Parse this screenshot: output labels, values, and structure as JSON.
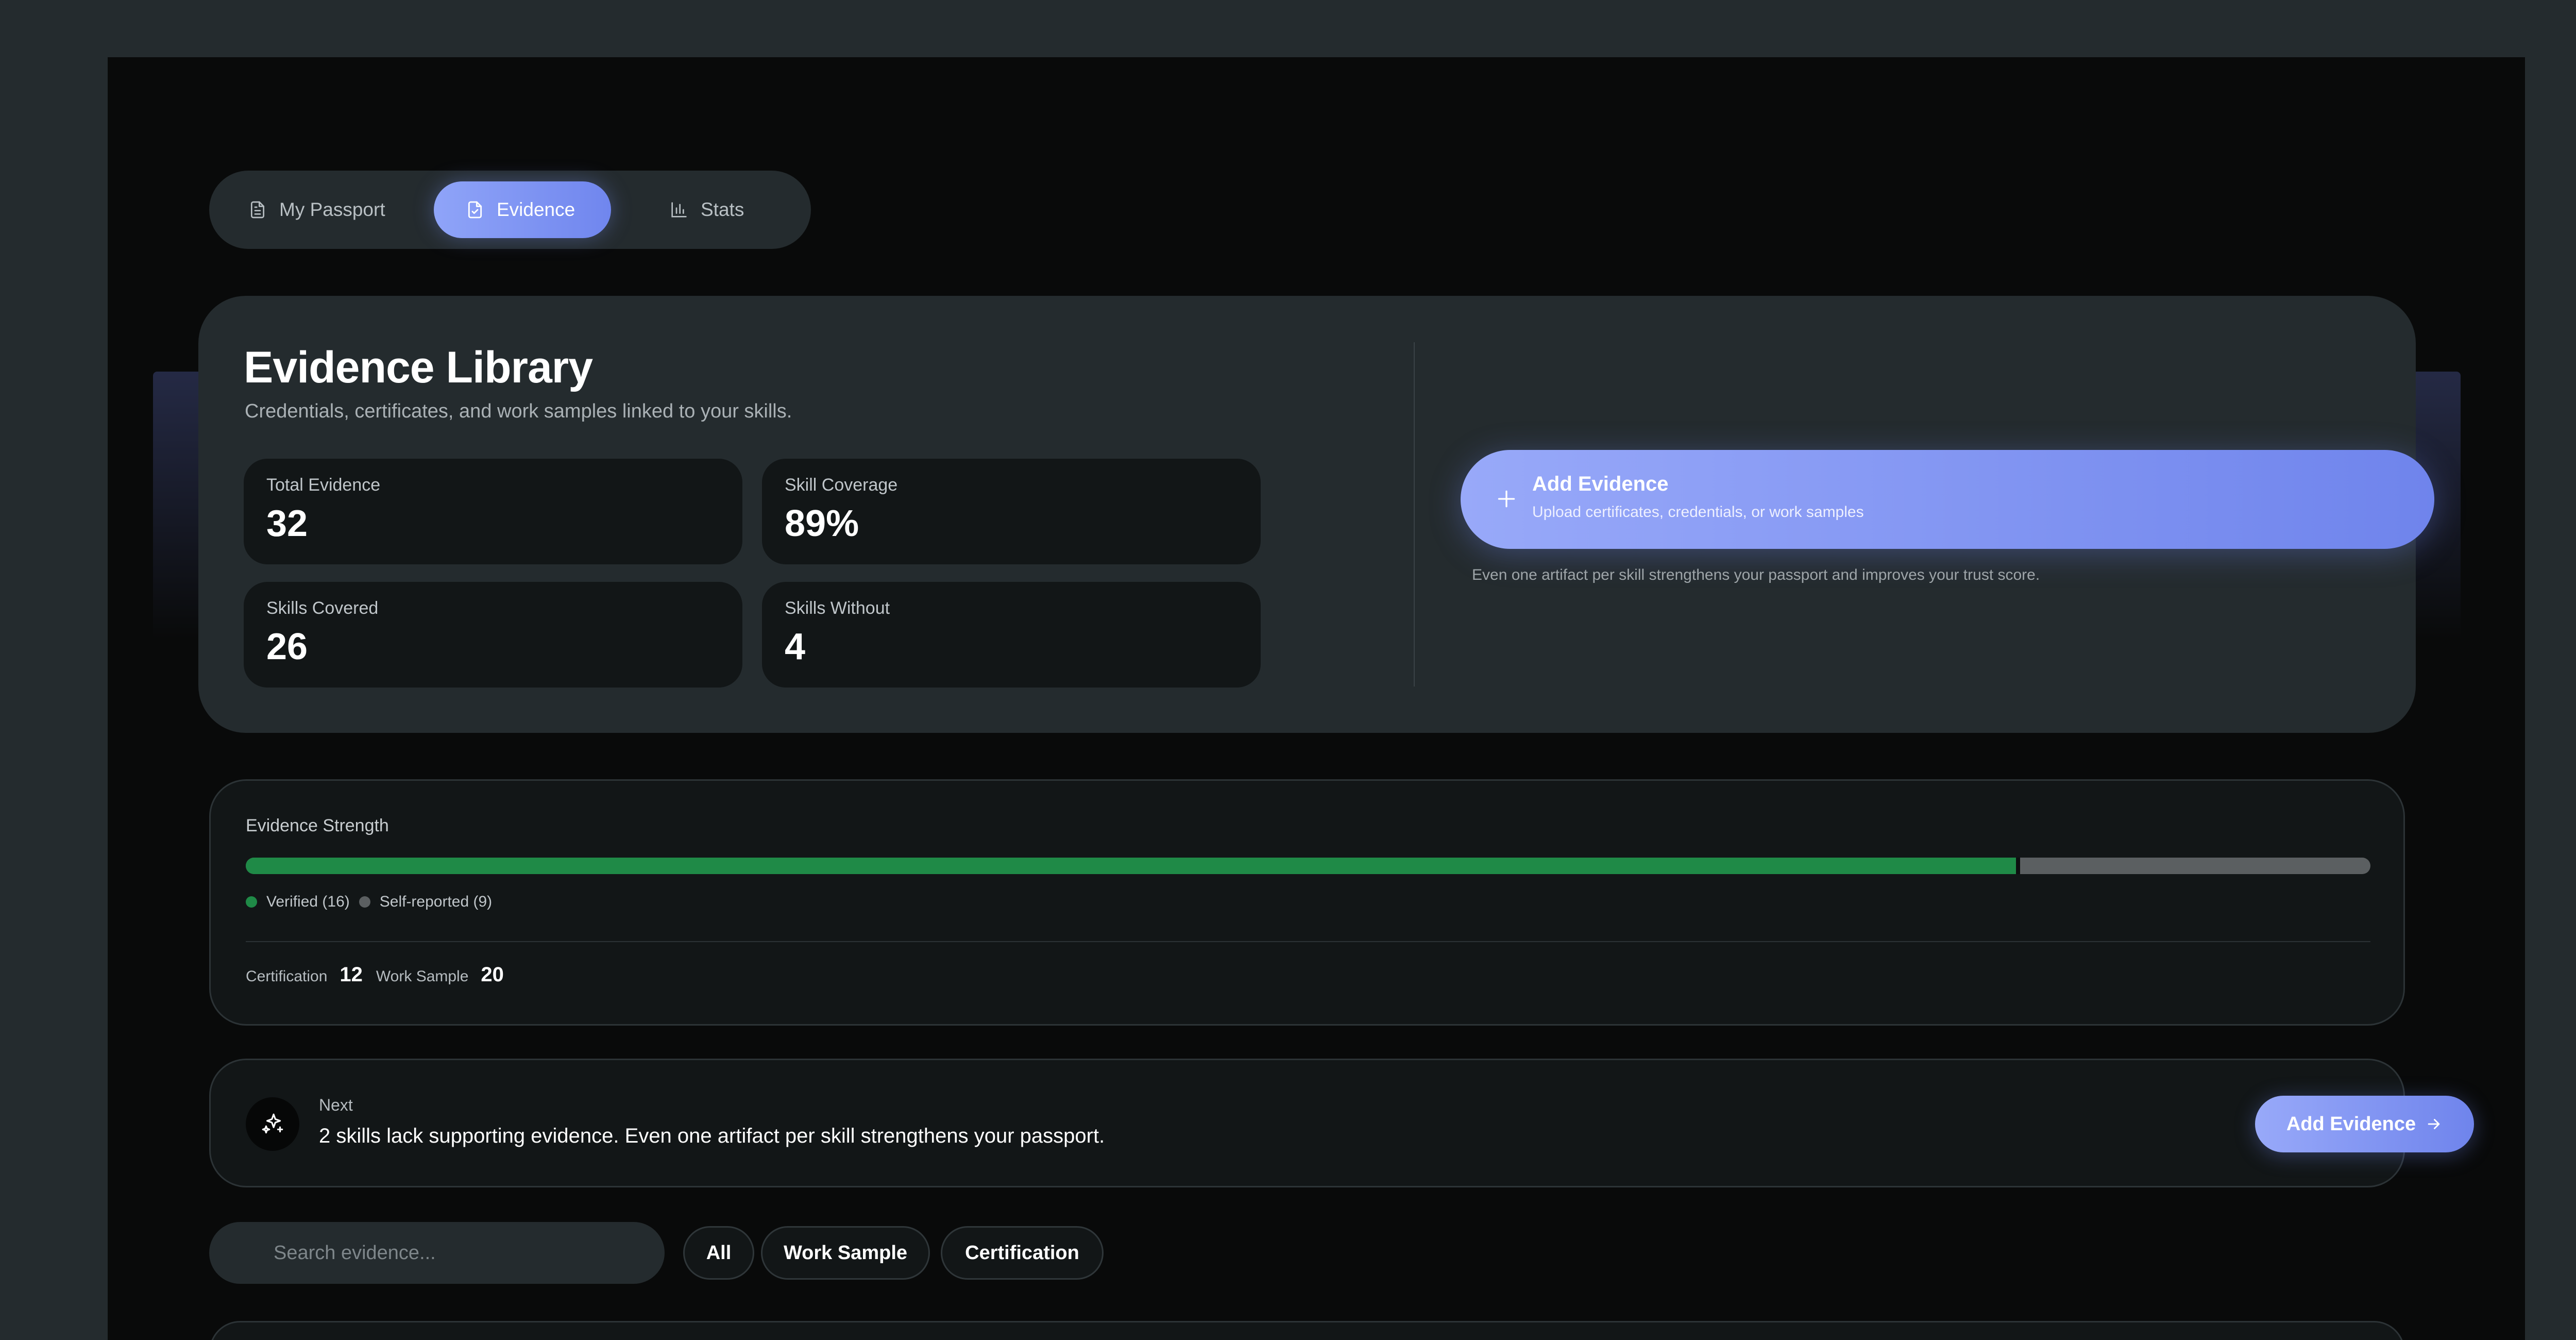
{
  "tabs": [
    {
      "label": "My Passport",
      "icon": "document-icon"
    },
    {
      "label": "Evidence",
      "icon": "document-check-icon",
      "active": true
    },
    {
      "label": "Stats",
      "icon": "bar-chart-icon"
    }
  ],
  "header": {
    "title": "Evidence Library",
    "subtitle": "Credentials, certificates, and work samples linked to your skills."
  },
  "stats": [
    {
      "label": "Total Evidence",
      "value": "32"
    },
    {
      "label": "Skill Coverage",
      "value": "89%"
    },
    {
      "label": "Skills Covered",
      "value": "26"
    },
    {
      "label": "Skills Without",
      "value": "4"
    }
  ],
  "add_evidence": {
    "title": "Add Evidence",
    "subtitle": "Upload certificates, credentials, or work samples",
    "hint": "Even one artifact per skill strengthens your passport and improves your trust score."
  },
  "strength": {
    "title": "Evidence Strength",
    "verified_fraction": 0.835,
    "legend_verified": "Verified (16)",
    "legend_self": "Self-reported (9)",
    "types": [
      {
        "label": "Certification",
        "value": "12"
      },
      {
        "label": "Work Sample",
        "value": "20"
      }
    ],
    "colors": {
      "verified": "#1f8a47",
      "self_reported": "#5b5f61"
    }
  },
  "next": {
    "label": "Next",
    "text": "2 skills lack supporting evidence. Even one artifact per skill strengthens your passport.",
    "button": "Add Evidence"
  },
  "search": {
    "placeholder": "Search evidence..."
  },
  "filters": [
    "All",
    "Work Sample",
    "Certification"
  ],
  "accent": "#7c91f3"
}
